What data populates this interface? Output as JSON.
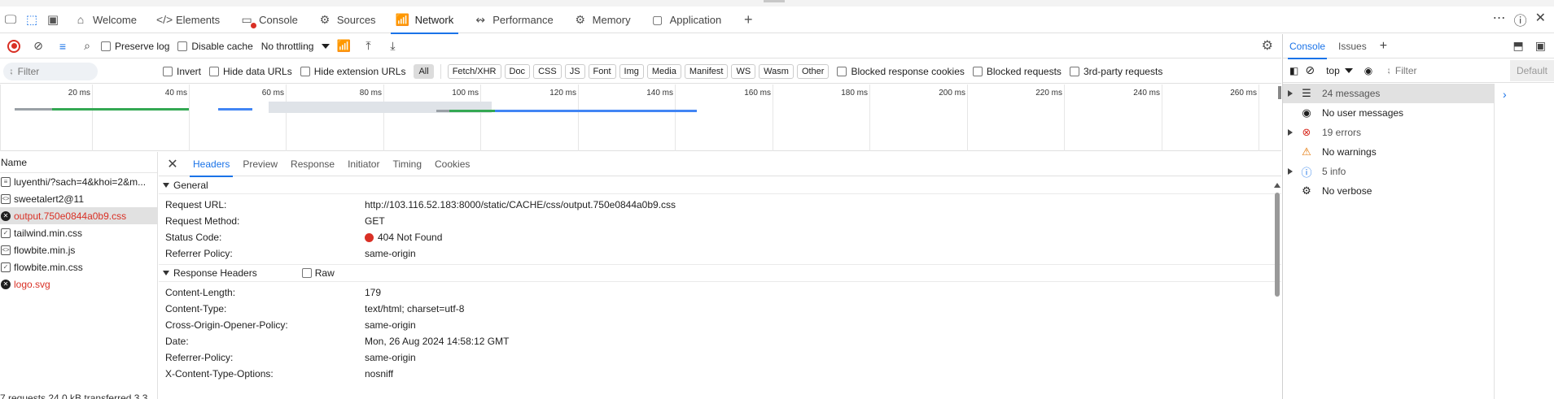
{
  "tabs": [
    {
      "label": "Welcome",
      "icon": "home-icon"
    },
    {
      "label": "Elements",
      "icon": "code-icon"
    },
    {
      "label": "Console",
      "icon": "console-icon"
    },
    {
      "label": "Sources",
      "icon": "bug-icon"
    },
    {
      "label": "Network",
      "icon": "wifi-icon"
    },
    {
      "label": "Performance",
      "icon": "performance-icon"
    },
    {
      "label": "Memory",
      "icon": "memory-icon"
    },
    {
      "label": "Application",
      "icon": "application-icon"
    }
  ],
  "toolbar": {
    "preserve_log": "Preserve log",
    "disable_cache": "Disable cache",
    "throttling": "No throttling"
  },
  "filters": {
    "placeholder": "Filter",
    "invert": "Invert",
    "hide_data_urls": "Hide data URLs",
    "hide_extension_urls": "Hide extension URLs",
    "types": [
      "All",
      "Fetch/XHR",
      "Doc",
      "CSS",
      "JS",
      "Font",
      "Img",
      "Media",
      "Manifest",
      "WS",
      "Wasm",
      "Other"
    ],
    "selected_type": "All",
    "blocked_response_cookies": "Blocked response cookies",
    "blocked_requests": "Blocked requests",
    "third_party": "3rd-party requests"
  },
  "timeline": {
    "ticks": [
      "20 ms",
      "40 ms",
      "60 ms",
      "80 ms",
      "100 ms",
      "120 ms",
      "140 ms",
      "160 ms",
      "180 ms",
      "200 ms",
      "220 ms",
      "240 ms",
      "260 ms"
    ]
  },
  "requests": {
    "header": "Name",
    "items": [
      {
        "name": "luyenthi/?sach=4&khoi=2&m...",
        "icon": "document-icon",
        "error": false
      },
      {
        "name": "sweetalert2@11",
        "icon": "script-icon",
        "error": false
      },
      {
        "name": "output.750e0844a0b9.css",
        "icon": "error-icon",
        "error": true
      },
      {
        "name": "tailwind.min.css",
        "icon": "stylesheet-icon",
        "error": false
      },
      {
        "name": "flowbite.min.js",
        "icon": "script-icon",
        "error": false
      },
      {
        "name": "flowbite.min.css",
        "icon": "stylesheet-icon",
        "error": false
      },
      {
        "name": "logo.svg",
        "icon": "error-icon",
        "error": true
      }
    ],
    "status": "7 requests  24.0 kB transferred  3.3"
  },
  "details": {
    "tabs": [
      "Headers",
      "Preview",
      "Response",
      "Initiator",
      "Timing",
      "Cookies"
    ],
    "general_title": "General",
    "general": [
      {
        "key": "Request URL:",
        "value": "http://103.116.52.183:8000/static/CACHE/css/output.750e0844a0b9.css"
      },
      {
        "key": "Request Method:",
        "value": "GET"
      },
      {
        "key": "Status Code:",
        "value": "404 Not Found"
      },
      {
        "key": "Referrer Policy:",
        "value": "same-origin"
      }
    ],
    "response_title": "Response Headers",
    "raw_label": "Raw",
    "response": [
      {
        "key": "Content-Length:",
        "value": "179"
      },
      {
        "key": "Content-Type:",
        "value": "text/html; charset=utf-8"
      },
      {
        "key": "Cross-Origin-Opener-Policy:",
        "value": "same-origin"
      },
      {
        "key": "Date:",
        "value": "Mon, 26 Aug 2024 14:58:12 GMT"
      },
      {
        "key": "Referrer-Policy:",
        "value": "same-origin"
      },
      {
        "key": "X-Content-Type-Options:",
        "value": "nosniff"
      }
    ]
  },
  "console": {
    "tabs": [
      "Console",
      "Issues"
    ],
    "context": "top",
    "filter_placeholder": "Filter",
    "default_levels": "Default",
    "sidebar": [
      {
        "label": "24 messages",
        "icon": "list-icon",
        "expandable": true
      },
      {
        "label": "No user messages",
        "icon": "user-icon",
        "expandable": false
      },
      {
        "label": "19 errors",
        "icon": "error-icon",
        "expandable": true
      },
      {
        "label": "No warnings",
        "icon": "warning-icon",
        "expandable": false
      },
      {
        "label": "5 info",
        "icon": "info-icon",
        "expandable": true
      },
      {
        "label": "No verbose",
        "icon": "verbose-icon",
        "expandable": false
      }
    ]
  },
  "colors": {
    "accent": "#1a73e8",
    "error": "#d93025",
    "warning": "#e37400",
    "info": "#1a73e8"
  }
}
